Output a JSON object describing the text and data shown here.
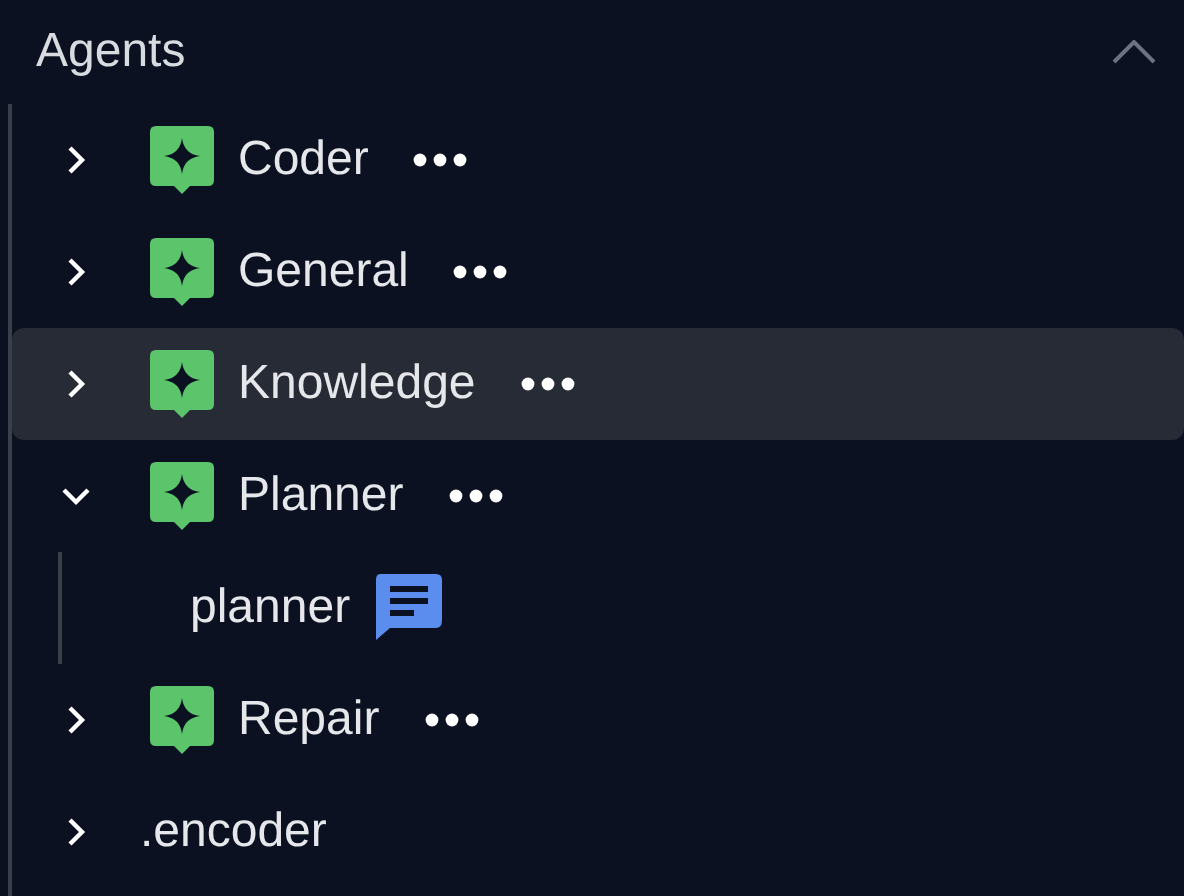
{
  "section": {
    "title": "Agents",
    "expanded": true
  },
  "items": [
    {
      "kind": "agent",
      "label": "Coder",
      "expanded": false,
      "selected": false
    },
    {
      "kind": "agent",
      "label": "General",
      "expanded": false,
      "selected": false
    },
    {
      "kind": "agent",
      "label": "Knowledge",
      "expanded": false,
      "selected": true
    },
    {
      "kind": "agent",
      "label": "Planner",
      "expanded": true,
      "selected": false,
      "children": [
        {
          "kind": "chat",
          "label": "planner",
          "selected": false
        }
      ]
    },
    {
      "kind": "agent",
      "label": "Repair",
      "expanded": false,
      "selected": false
    },
    {
      "kind": "folder",
      "label": ".encoder",
      "expanded": false,
      "selected": false
    }
  ]
}
